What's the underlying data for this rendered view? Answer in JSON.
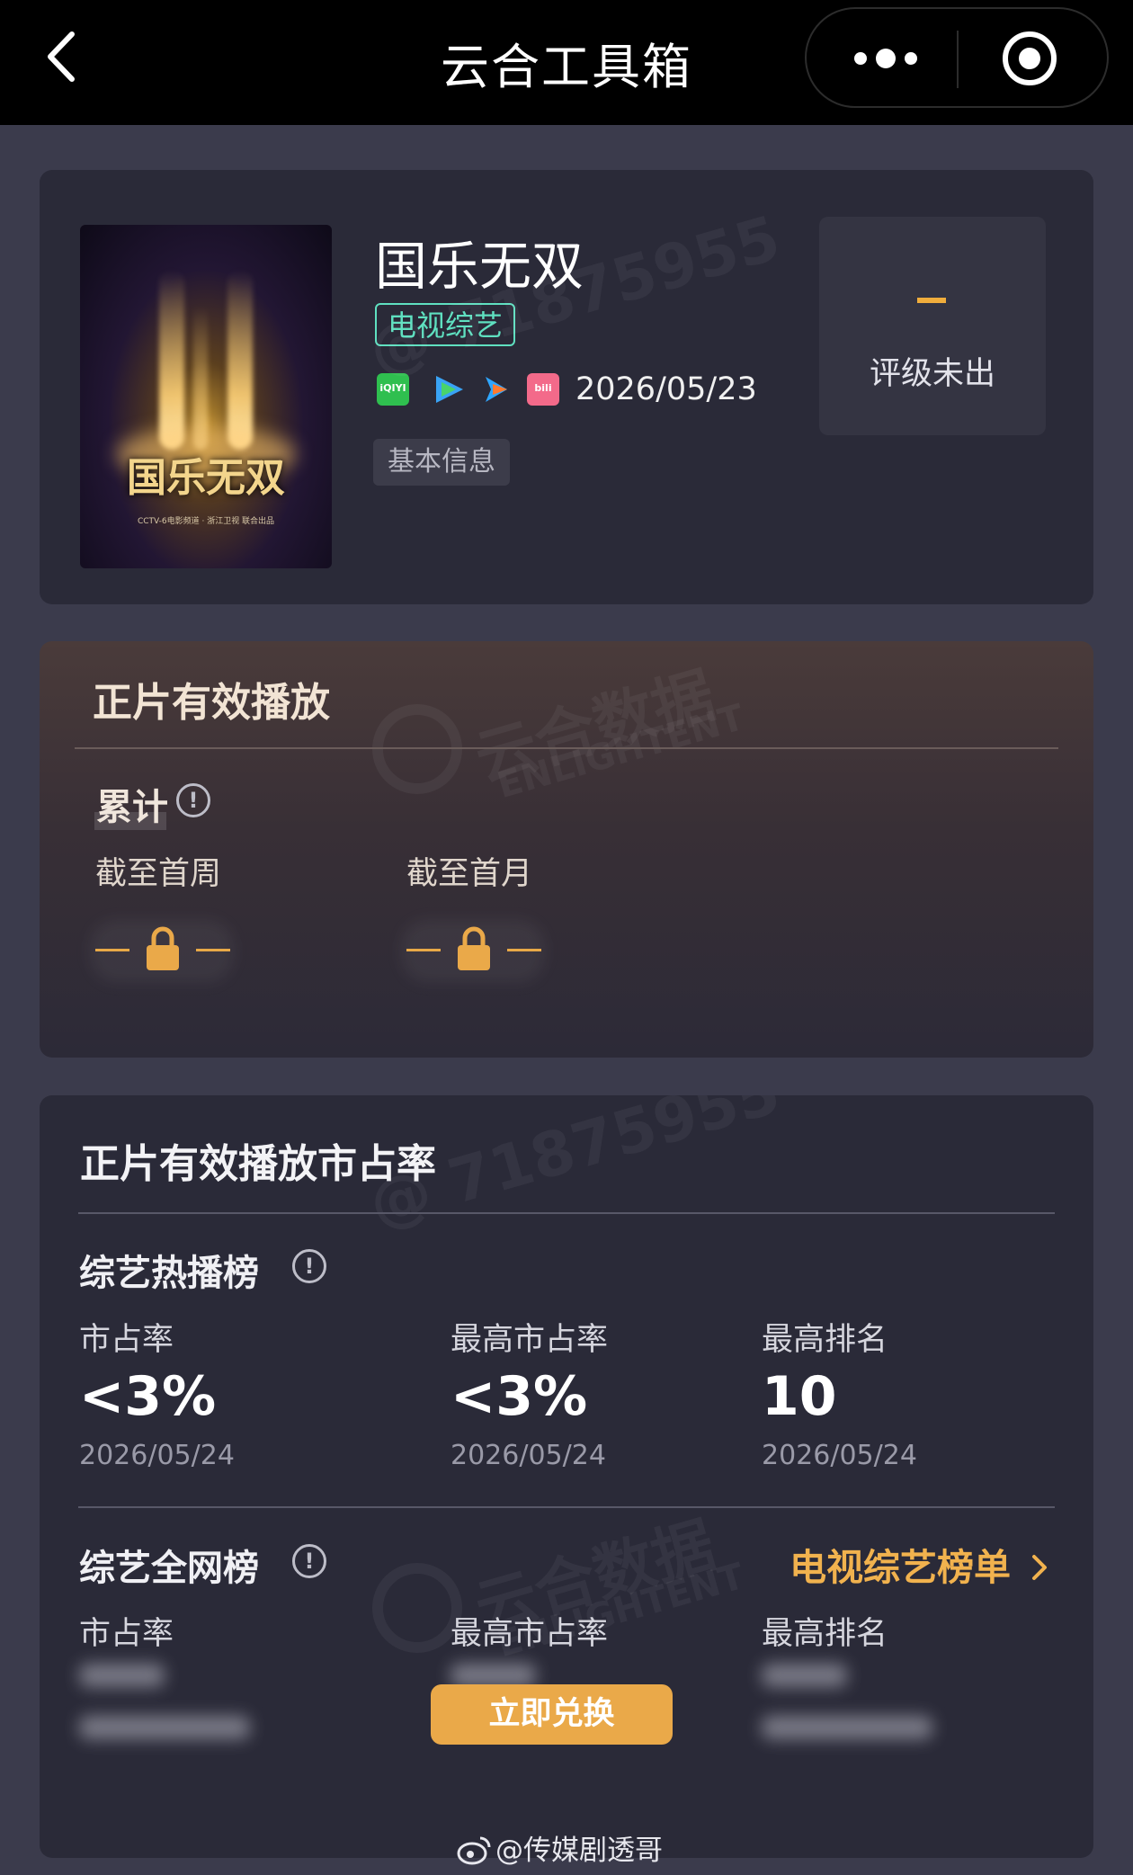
{
  "topbar": {
    "title": "云合工具箱"
  },
  "show": {
    "poster_title": "国乐无双",
    "poster_subtitle": "CCTV-6电影频道 · 浙江卫视 联合出品",
    "title": "国乐无双",
    "genre_tag": "电视综艺",
    "platforms": [
      "iqiyi-icon",
      "tencent-video-icon",
      "youku-icon",
      "bilibili-icon"
    ],
    "platform_labels": {
      "iqiyi": "iQIYI",
      "bilibili": "bili"
    },
    "release_date": "2026/05/23",
    "info_tag": "基本信息",
    "rating": {
      "value": "-",
      "label": "评级未出"
    }
  },
  "effective_play": {
    "title": "正片有效播放",
    "cumulative_label": "累计",
    "metrics": [
      {
        "label": "截至首周",
        "locked": true
      },
      {
        "label": "截至首月",
        "locked": true
      }
    ]
  },
  "market_share": {
    "title": "正片有效播放市占率",
    "hot_chart": {
      "title": "综艺热播榜",
      "columns": [
        {
          "label": "市占率",
          "value": "<3%",
          "date": "2026/05/24"
        },
        {
          "label": "最高市占率",
          "value": "<3%",
          "date": "2026/05/24"
        },
        {
          "label": "最高排名",
          "value": "10",
          "date": "2026/05/24"
        }
      ]
    },
    "network_chart": {
      "title": "综艺全网榜",
      "link": "电视综艺榜单",
      "columns": [
        {
          "label": "市占率"
        },
        {
          "label": "最高市占率"
        },
        {
          "label": "最高排名"
        }
      ],
      "redeem_button": "立即兑换"
    }
  },
  "watermarks": {
    "id": "@ 71875955",
    "brand_cn": "云合数据",
    "brand_en": "ENLIGHTENT"
  },
  "credit": "@传媒剧透哥",
  "colors": {
    "accent": "#eaa949",
    "genre_tag": "#5fe0c0",
    "card_bg": "#2a2a38",
    "page_bg": "#3b3b4c"
  }
}
